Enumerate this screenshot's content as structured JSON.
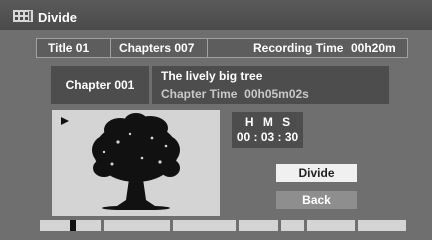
{
  "window": {
    "title": "Divide",
    "icon": "divide-film-icon"
  },
  "info_bar": {
    "title": "Title 01",
    "chapters": "Chapters 007",
    "recording_time_label": "Recording Time",
    "recording_time": "00h20m"
  },
  "chapter": {
    "number": "Chapter 001",
    "name": "The lively big tree",
    "time_label": "Chapter Time",
    "time": "00h05m02s"
  },
  "preview": {
    "status_icon": "play-icon",
    "image": "tree-thumbnail"
  },
  "position": {
    "heading": "H M S",
    "value": "00 : 03 : 30"
  },
  "buttons": {
    "divide": "Divide",
    "back": "Back"
  },
  "colors": {
    "background": "#6f6f6f",
    "panel": "#4d4d4d",
    "selected_button": "#f0f0f0",
    "button": "#8e8e8e",
    "timeline": "#d4d4d4"
  },
  "timeline": {
    "chapter_count": 7,
    "current_chapter": 1,
    "position_fraction": 0.7
  }
}
